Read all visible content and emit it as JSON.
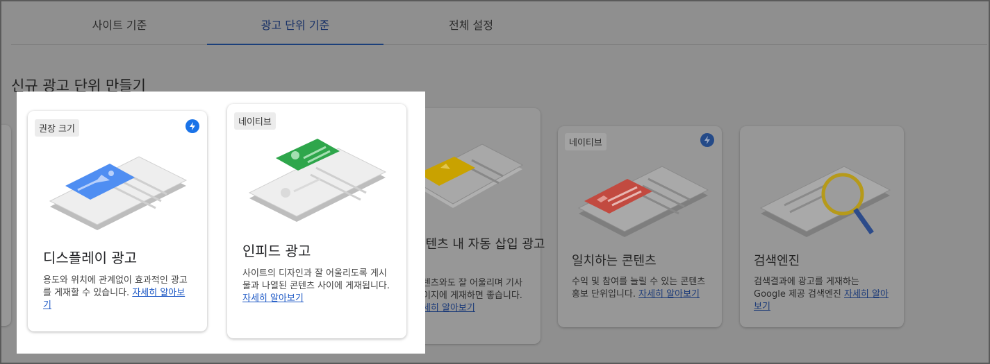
{
  "tabs": [
    {
      "label": "사이트 기준",
      "active": false
    },
    {
      "label": "광고 단위 기준",
      "active": true
    },
    {
      "label": "전체 설정",
      "active": false
    }
  ],
  "section_title": "신규 광고 단위 만들기",
  "cards": [
    {
      "id": "display",
      "badge": "권장 크기",
      "has_bolt": true,
      "title": "디스플레이 광고",
      "desc": "용도와 위치에 관계없이 효과적인 광고를 게재할 수 있습니다.",
      "link": "자세히 알아보기",
      "illus_color": "#4f8ef2"
    },
    {
      "id": "infeed",
      "badge": "네이티브",
      "has_bolt": false,
      "title": "인피드 광고",
      "desc": "사이트의 디자인과 잘 어울리도록 게시물과 나열된 콘텐츠 사이에 게재됩니다.",
      "link": "자세히 알아보기",
      "illus_color": "#2ea64b"
    },
    {
      "id": "inarticle",
      "badge": "",
      "has_bolt": false,
      "title": "콘텐츠 내 자동 삽입 광고",
      "desc": "콘텐츠와도 잘 어울리며 기사 페이지에 게재하면 좋습니다.",
      "link": "자세히 알아보기",
      "illus_color": "#c9a200"
    },
    {
      "id": "matched",
      "badge": "네이티브",
      "has_bolt": true,
      "title": "일치하는 콘텐츠",
      "desc": "수익 및 참여를 늘릴 수 있는 콘텐츠 홍보 단위입니다.",
      "link": "자세히 알아보기",
      "illus_color": "#c24a40"
    },
    {
      "id": "search",
      "badge": "",
      "has_bolt": false,
      "title": "검색엔진",
      "desc": "검색결과에 광고를 게재하는 Google 제공 검색엔진",
      "link": "자세히 알아보기",
      "illus_color": "#b69a1a"
    }
  ]
}
